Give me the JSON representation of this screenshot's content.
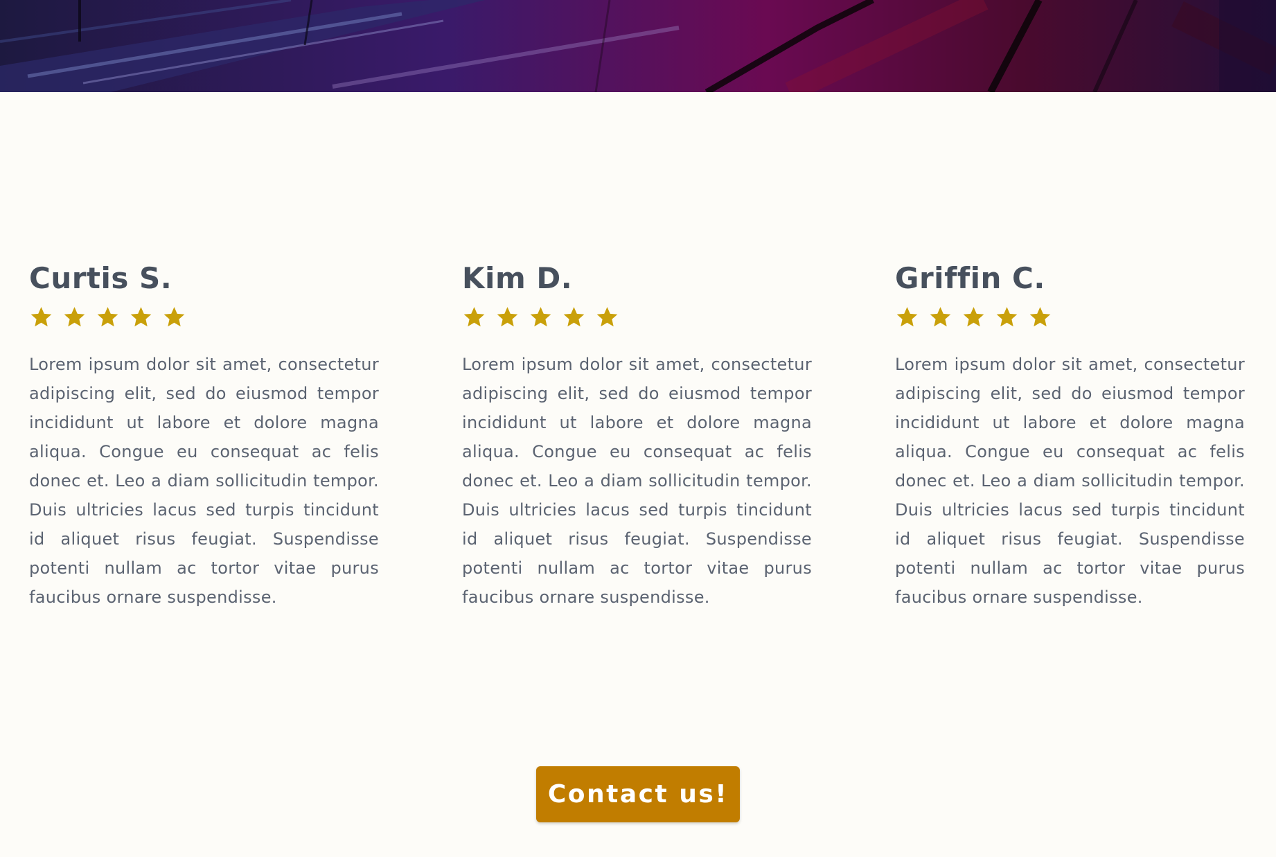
{
  "colors": {
    "background": "#fdfcf8",
    "heading": "#47505d",
    "body_text": "#5b6371",
    "star": "#c9a00a",
    "button": "#c17d00",
    "button_text": "#ffffff"
  },
  "hero": {
    "image": "purple-abstract-banner"
  },
  "reviews": [
    {
      "name": "Curtis S.",
      "rating": 5,
      "rating_max": 5,
      "text": "Lorem ipsum dolor sit amet, consectetur adipiscing elit, sed do eiusmod tempor incididunt ut labore et dolore magna aliqua. Congue eu consequat ac felis donec et. Leo a diam sollicitudin tempor. Duis ultricies lacus sed turpis tincidunt id aliquet risus feugiat. Suspendisse potenti nullam ac tortor vitae purus faucibus ornare suspendisse."
    },
    {
      "name": "Kim D.",
      "rating": 5,
      "rating_max": 5,
      "text": "Lorem ipsum dolor sit amet, consectetur adipiscing elit, sed do eiusmod tempor incididunt ut labore et dolore magna aliqua. Congue eu consequat ac felis donec et. Leo a diam sollicitudin tempor. Duis ultricies lacus sed turpis tincidunt id aliquet risus feugiat. Suspendisse potenti nullam ac tortor vitae purus faucibus ornare suspendisse."
    },
    {
      "name": "Griffin C.",
      "rating": 5,
      "rating_max": 5,
      "text": "Lorem ipsum dolor sit amet, consectetur adipiscing elit, sed do eiusmod tempor incididunt ut labore et dolore magna aliqua. Congue eu consequat ac felis donec et. Leo a diam sollicitudin tempor. Duis ultricies lacus sed turpis tincidunt id aliquet risus feugiat. Suspendisse potenti nullam ac tortor vitae purus faucibus ornare suspendisse."
    }
  ],
  "cta": {
    "label": "Contact us!"
  }
}
